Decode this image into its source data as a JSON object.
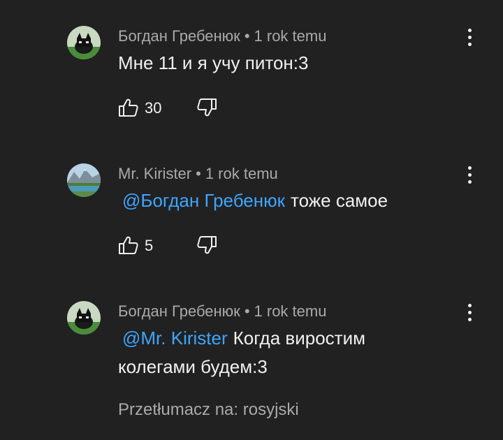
{
  "comments": [
    {
      "author": "Богдан Гребенюк",
      "separator": "•",
      "time": "1 rok temu",
      "text": "Мне 11 и я учу питон:3",
      "likes": "30",
      "avatar_icon": "black-cat-avatar-icon"
    },
    {
      "author": "Mr. Kirister",
      "separator": "•",
      "time": "1 rok temu",
      "mention": "@Богдан Гребенюк",
      "text": "тоже самое",
      "likes": "5",
      "avatar_icon": "mountain-lake-avatar-icon"
    },
    {
      "author": "Богдан Гребенюк",
      "separator": "•",
      "time": "1 rok temu",
      "mention": "@Mr. Kirister",
      "text_line1": "Когда виростим",
      "text_line2": "колегами будем:3",
      "translate_label": "Przetłumacz na: rosyjski",
      "avatar_icon": "black-cat-avatar-icon"
    }
  ],
  "icons": {
    "like": "thumb-up-icon",
    "dislike": "thumb-down-icon",
    "menu": "more-vertical-icon"
  },
  "colors": {
    "background": "#212121",
    "text": "#f1f1f1",
    "secondary": "#aaaaaa",
    "mention": "#3ea6ff"
  }
}
